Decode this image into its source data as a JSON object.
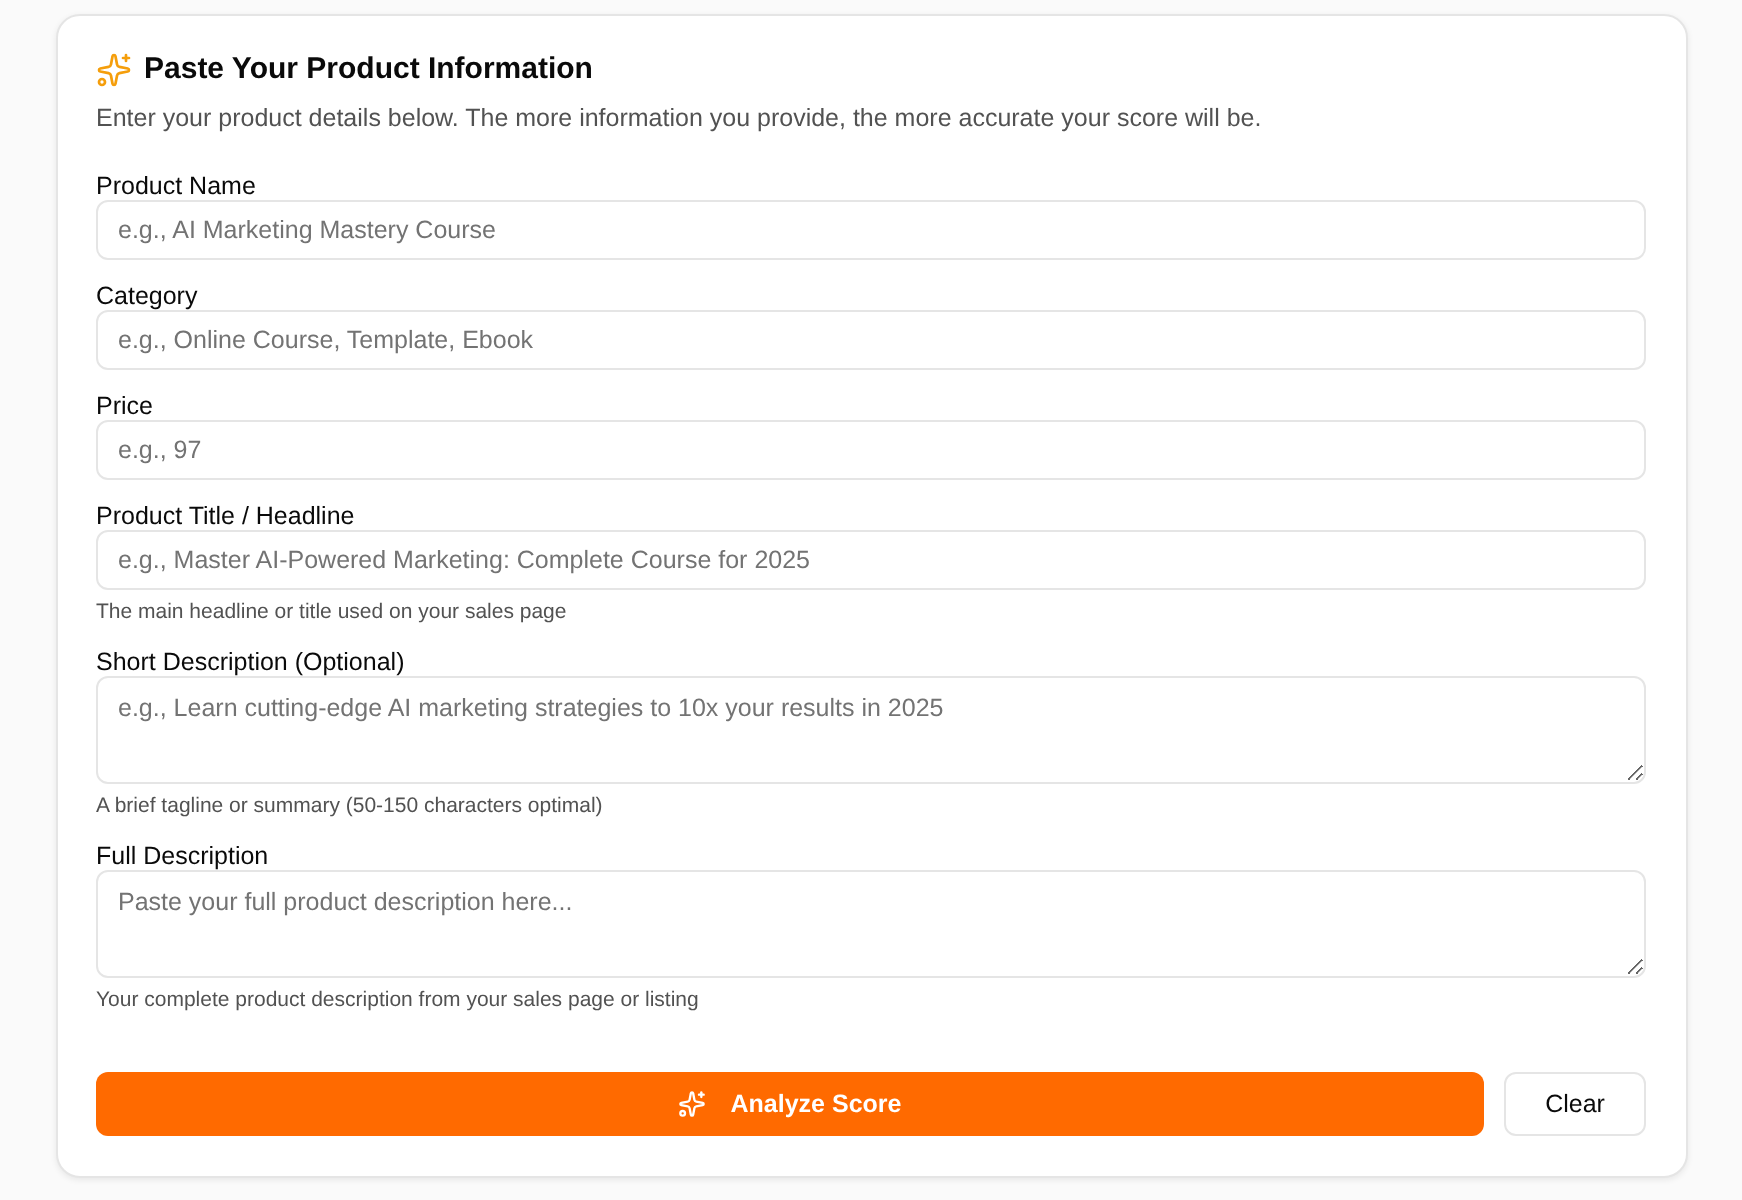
{
  "header": {
    "title": "Paste Your Product Information",
    "subtitle": "Enter your product details below. The more information you provide, the more accurate your score will be."
  },
  "fields": [
    {
      "kind": "input",
      "label": "Product Name",
      "placeholder": "e.g., AI Marketing Mastery Course"
    },
    {
      "kind": "input",
      "label": "Category",
      "placeholder": "e.g., Online Course, Template, Ebook"
    },
    {
      "kind": "input",
      "label": "Price",
      "placeholder": "e.g., 97"
    },
    {
      "kind": "input",
      "label": "Product Title / Headline",
      "placeholder": "e.g., Master AI-Powered Marketing: Complete Course for 2025",
      "help": "The main headline or title used on your sales page"
    },
    {
      "kind": "textarea",
      "label": "Short Description (Optional)",
      "placeholder": "e.g., Learn cutting-edge AI marketing strategies to 10x your results in 2025",
      "help": "A brief tagline or summary (50-150 characters optimal)"
    },
    {
      "kind": "textarea",
      "label": "Full Description",
      "placeholder": "Paste your full product description here...",
      "help": "Your complete product description from your sales page or listing"
    }
  ],
  "actions": [
    {
      "kind": "primary",
      "label": "Analyze Score"
    },
    {
      "kind": "secondary",
      "label": "Clear"
    }
  ]
}
